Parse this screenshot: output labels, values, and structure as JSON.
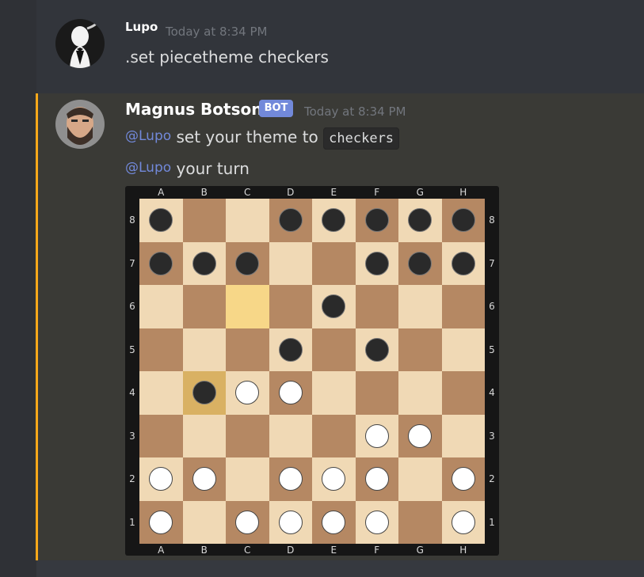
{
  "messages": [
    {
      "author": "Lupo",
      "timestamp": "Today at 8:34 PM",
      "text": ".set piecetheme checkers",
      "avatar_icon": "tuxedo-penguin-avatar"
    },
    {
      "author": "Magnus Botson",
      "tag": "BOT",
      "timestamp": "Today at 8:34 PM",
      "avatar_icon": "bearded-man-avatar",
      "line1": {
        "mention": "@Lupo",
        "text": " set your theme to ",
        "code": "checkers"
      },
      "line2": {
        "mention": "@Lupo",
        "text": " your turn"
      }
    }
  ],
  "board": {
    "files": [
      "A",
      "B",
      "C",
      "D",
      "E",
      "F",
      "G",
      "H"
    ],
    "ranks": [
      "8",
      "7",
      "6",
      "5",
      "4",
      "3",
      "2",
      "1"
    ],
    "highlight": [
      "C6",
      "B4"
    ],
    "rows": [
      "b..bbbbb",
      "bbb..bbb",
      "....b...",
      "...b.b..",
      ".bww....",
      ".....ww.",
      "ww.www.w",
      "w.wwww.w"
    ]
  },
  "colors": {
    "light_square": "#f0d9b5",
    "dark_square": "#b58863",
    "highlight": "#f7d788",
    "mention": "#7289da",
    "mention_bar": "#faa81a",
    "bot_tag": "#7289da"
  }
}
